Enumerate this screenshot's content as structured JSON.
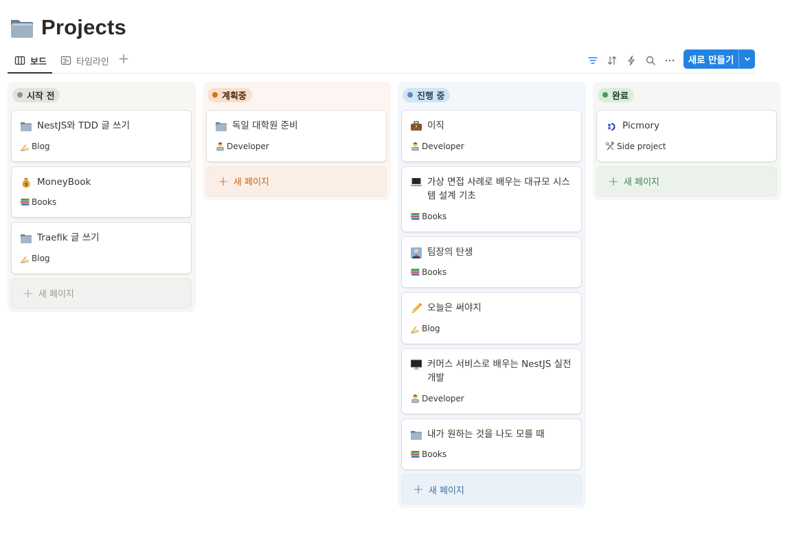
{
  "page": {
    "title": "Projects",
    "icon": "folder-icon"
  },
  "views": {
    "tabs": [
      {
        "label": "보드",
        "icon": "board-icon",
        "active": true
      },
      {
        "label": "타임라인",
        "icon": "timeline-icon",
        "active": false
      }
    ],
    "add_icon": "plus-icon"
  },
  "toolbar": {
    "tools": [
      "filter-icon",
      "sort-icon",
      "lightning-icon",
      "search-icon",
      "more-icon"
    ],
    "new_label": "새로 만들기",
    "accent": "#2383e2"
  },
  "columns": [
    {
      "name": "시작 전",
      "colors": {
        "bg": "#f7f6f3",
        "pill": "#e3e2e0",
        "dot": "#91918e",
        "text": "#32302c",
        "new": "#9b9a97",
        "newbg": "#f1f1ef"
      },
      "cards": [
        {
          "title": "NestJS와 TDD 글 쓰기",
          "icon": "folder-icon",
          "tag": "Blog",
          "tag_icon": "writing-hand-icon"
        },
        {
          "title": "MoneyBook",
          "icon": "money-bag-icon",
          "tag": "Books",
          "tag_icon": "books-icon"
        },
        {
          "title": "Traefik 글 쓰기",
          "icon": "folder-icon",
          "tag": "Blog",
          "tag_icon": "writing-hand-icon"
        }
      ],
      "new_label": "새 페이지"
    },
    {
      "name": "계획중",
      "colors": {
        "bg": "#fcf5f1",
        "pill": "#f9dfd0",
        "dot": "#d9730d",
        "text": "#49290e",
        "new": "#c4651b",
        "newbg": "#fbeee6"
      },
      "cards": [
        {
          "title": "독일 대학원 준비",
          "icon": "folder-icon",
          "tag": "Developer",
          "tag_icon": "technologist-icon"
        }
      ],
      "new_label": "새 페이지"
    },
    {
      "name": "진행 중",
      "colors": {
        "bg": "#f3f7fb",
        "pill": "#d3e5ef",
        "dot": "#5e87c9",
        "text": "#28456c",
        "new": "#3e6ea5",
        "newbg": "#eaf1f7"
      },
      "cards": [
        {
          "title": "이직",
          "icon": "briefcase-icon",
          "tag": "Developer",
          "tag_icon": "technologist-icon"
        },
        {
          "title": "가상 면접 사례로 배우는 대규모 시스템 설계 기초",
          "icon": "laptop-icon",
          "tag": "Books",
          "tag_icon": "books-icon"
        },
        {
          "title": "팀장의 탄생",
          "icon": "person-suit-icon",
          "tag": "Books",
          "tag_icon": "books-icon"
        },
        {
          "title": "오늘은 써야지",
          "icon": "pencil-icon",
          "tag": "Blog",
          "tag_icon": "writing-hand-icon"
        },
        {
          "title": "커머스 서비스로 배우는 NestJS 실전 개발",
          "icon": "desktop-icon",
          "tag": "Developer",
          "tag_icon": "technologist-icon"
        },
        {
          "title": "내가 원하는 것을 나도 모를 때",
          "icon": "folder-icon",
          "tag": "Books",
          "tag_icon": "books-icon"
        }
      ],
      "new_label": "새 페이지"
    },
    {
      "name": "완료",
      "colors": {
        "bg": "#f4f7f3",
        "pill": "#dbeddb",
        "dot": "#4f9768",
        "text": "#1c3829",
        "new": "#448361",
        "newbg": "#ebf2ea"
      },
      "cards": [
        {
          "title": "Picmory",
          "icon": "picmory-logo-icon",
          "tag": "Side project",
          "tag_icon": "hammer-wrench-icon"
        }
      ],
      "new_label": "새 페이지"
    }
  ]
}
